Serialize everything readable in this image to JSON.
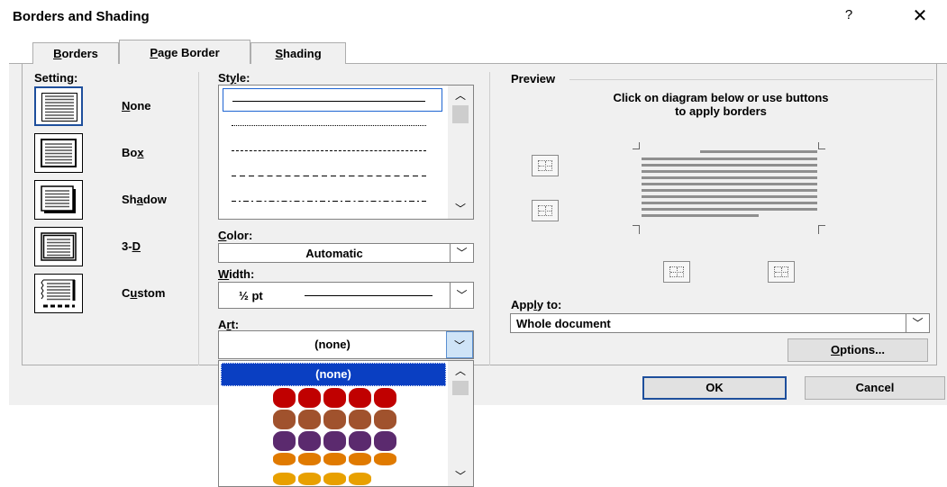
{
  "window": {
    "title": "Borders and Shading",
    "help_glyph": "?",
    "close_glyph": "✕"
  },
  "tabs": [
    {
      "label": "Borders",
      "active": false,
      "mnemonic_char": "B",
      "rest": "orders"
    },
    {
      "label": "Page Border",
      "active": true,
      "mnemonic_char": "P",
      "rest": "age Border"
    },
    {
      "label": "Shading",
      "active": false,
      "mnemonic_char": "S",
      "rest": "hading"
    }
  ],
  "setting": {
    "label": "Setting:",
    "items": [
      {
        "id": "none",
        "label": "None",
        "pre": "",
        "mn": "N",
        "post": "one",
        "selected": true
      },
      {
        "id": "box",
        "label": "Box",
        "pre": "Bo",
        "mn": "x",
        "post": "",
        "selected": false
      },
      {
        "id": "shadow",
        "label": "Shadow",
        "pre": "Sh",
        "mn": "a",
        "post": "dow",
        "selected": false
      },
      {
        "id": "3d",
        "label": "3-D",
        "pre": "3-",
        "mn": "D",
        "post": "",
        "selected": false
      },
      {
        "id": "custom",
        "label": "Custom",
        "pre": "C",
        "mn": "u",
        "post": "stom",
        "selected": false
      }
    ]
  },
  "style": {
    "label": "Style:",
    "pre": "St",
    "mn": "y",
    "post": "le:",
    "styles": [
      "solid",
      "dotted",
      "small-dash",
      "dash",
      "dash-dot"
    ],
    "selected_index": 0
  },
  "color": {
    "label": "Color:",
    "mn": "C",
    "post": "olor:",
    "value": "Automatic"
  },
  "width": {
    "label": "Width:",
    "mn": "W",
    "post": "idth:",
    "value": "½ pt"
  },
  "art": {
    "label": "Art:",
    "pre": "A",
    "mn": "r",
    "post": "t:",
    "value": "(none)",
    "options": [
      "(none)"
    ]
  },
  "preview": {
    "label": "Preview",
    "instruction_line1": "Click on diagram below or use buttons",
    "instruction_line2": "to apply borders"
  },
  "apply_to": {
    "label": "Apply to:",
    "pre": "App",
    "mn": "l",
    "post": "y to:",
    "value": "Whole document"
  },
  "buttons": {
    "options": {
      "label": "Options...",
      "mn": "O",
      "post": "ptions..."
    },
    "ok": "OK",
    "cancel": "Cancel"
  },
  "colors": {
    "accent": "#1e4f9c",
    "selection": "#0a3fc2",
    "dialog_bg": "#f0f0f0"
  },
  "icons": [
    "help-icon",
    "close-icon",
    "chevron-up-icon",
    "chevron-down-icon",
    "border-top-icon",
    "border-bottom-icon",
    "border-left-icon",
    "border-right-icon"
  ]
}
